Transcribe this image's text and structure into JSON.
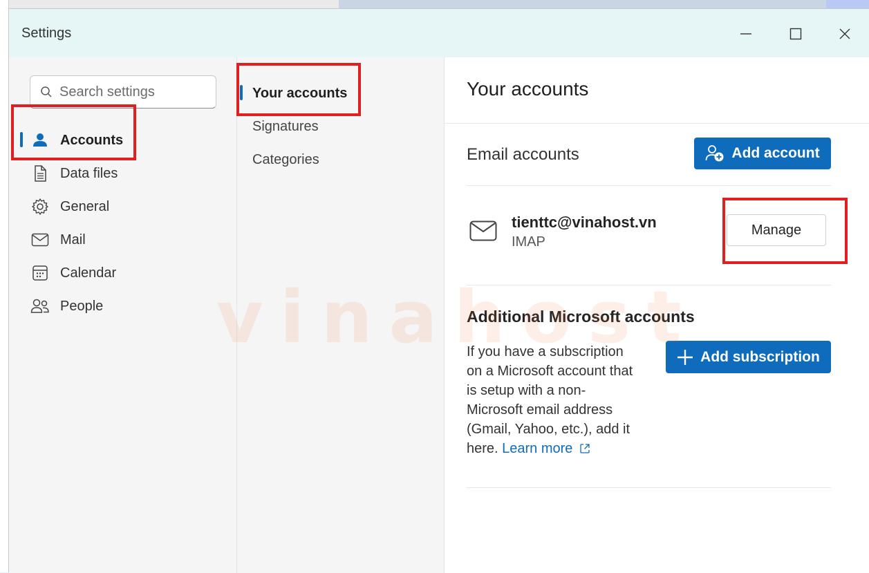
{
  "window": {
    "title": "Settings"
  },
  "search": {
    "placeholder": "Search settings"
  },
  "nav": {
    "items": [
      {
        "label": "Accounts",
        "icon": "person-icon",
        "active": true
      },
      {
        "label": "Data files",
        "icon": "document-icon"
      },
      {
        "label": "General",
        "icon": "gear-icon"
      },
      {
        "label": "Mail",
        "icon": "mail-icon"
      },
      {
        "label": "Calendar",
        "icon": "calendar-icon"
      },
      {
        "label": "People",
        "icon": "people-icon"
      }
    ]
  },
  "subnav": {
    "items": [
      {
        "label": "Your accounts",
        "active": true
      },
      {
        "label": "Signatures"
      },
      {
        "label": "Categories"
      }
    ]
  },
  "content": {
    "title": "Your accounts",
    "email_accounts": {
      "title": "Email accounts",
      "add_button": "Add account",
      "account": {
        "email": "tienttc@vinahost.vn",
        "type": "IMAP",
        "manage_button": "Manage"
      }
    },
    "additional": {
      "title": "Additional Microsoft accounts",
      "description": "If you have a subscription on a Microsoft account that is setup with a non-Microsoft email address (Gmail, Yahoo, etc.), add it here.",
      "learn_more": "Learn more",
      "add_button": "Add subscription"
    }
  },
  "watermark": "vinahost",
  "colors": {
    "accent": "#0f6cbd",
    "highlight": "#e02020",
    "titlebar": "#e6f5f6"
  }
}
